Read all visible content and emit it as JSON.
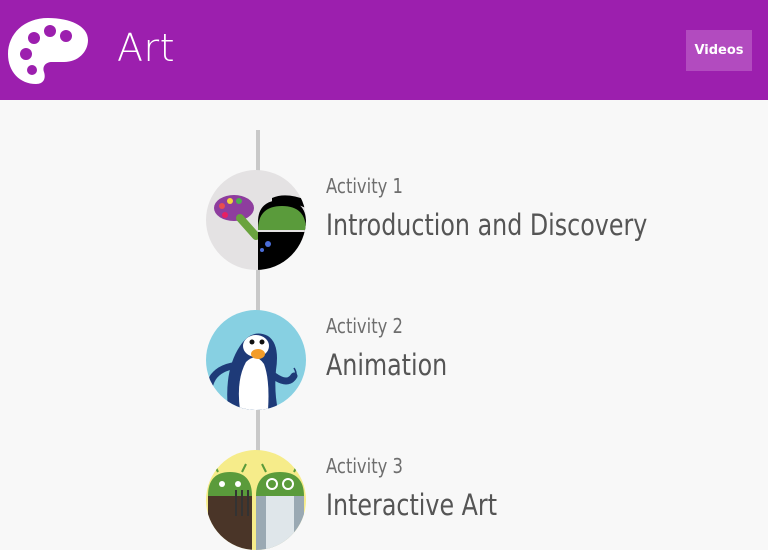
{
  "header": {
    "title": "Art",
    "videos_label": "Videos",
    "background_color": "#9c1fae",
    "logo_icon": "palette-icon"
  },
  "activities": [
    {
      "number": "Activity 1",
      "title": "Introduction and Discovery",
      "icon": "palette-android-icon"
    },
    {
      "number": "Activity 2",
      "title": "Animation",
      "icon": "penguin-icon"
    },
    {
      "number": "Activity 3",
      "title": "Interactive Art",
      "icon": "android-robots-icon"
    }
  ]
}
